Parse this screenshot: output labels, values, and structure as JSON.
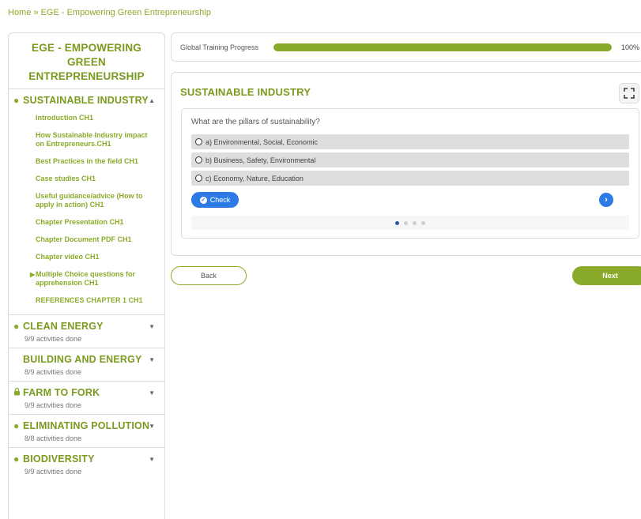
{
  "breadcrumb": {
    "home": "Home",
    "separator": "»",
    "current": "EGE - Empowering Green Entrepreneurship"
  },
  "sidebar": {
    "course_title": "EGE - EMPOWERING GREEN ENTREPRENEURSHIP",
    "chapters": [
      {
        "title": "SUSTAINABLE INDUSTRY",
        "bullet": "●",
        "toggle": "▲",
        "expanded": true,
        "lessons": [
          "Introduction CH1",
          "How Sustainable Industry impact on Entrepreneurs.CH1",
          "Best Practices in the field CH1",
          "Case studies CH1",
          "Useful guidance/advice (How to apply in action) CH1",
          "Chapter Presentation CH1",
          "Chapter Document PDF CH1",
          "Chapter video CH1",
          "Multiple Choice questions for apprehension CH1",
          "REFERENCES CHAPTER 1 CH1"
        ],
        "current_lesson_caret": "▶"
      },
      {
        "title": "CLEAN ENERGY",
        "bullet": "●",
        "toggle": "▼",
        "status": "9/9 activities done"
      },
      {
        "title": "BUILDING AND ENERGY",
        "bullet": "",
        "toggle": "▼",
        "status": "8/9 activities done"
      },
      {
        "title": "FARM TO FORK",
        "bullet": "🔒",
        "icon": "lock-icon",
        "toggle": "▼",
        "status": "9/9 activities done"
      },
      {
        "title": "ELIMINATING POLLUTION",
        "bullet": "●",
        "toggle": "▼",
        "status": "8/8 activities done"
      },
      {
        "title": "BIODIVERSITY",
        "bullet": "●",
        "toggle": "▼",
        "status": "9/9 activities done"
      }
    ]
  },
  "progress": {
    "label": "Global Training Progress",
    "value_text": "100%",
    "fraction": 1.0
  },
  "section": {
    "title": "SUSTAINABLE INDUSTRY"
  },
  "quiz": {
    "question": "What are the pillars of sustainability?",
    "options": [
      "a) Environmental, Social, Economic",
      "b) Business, Safety, Environmental",
      "c) Economy, Nature, Education"
    ],
    "check_label": "Check",
    "next_arrow": "›",
    "page_dots": 4,
    "active_dot": 0
  },
  "nav": {
    "back_label": "Back",
    "next_label": "Next"
  },
  "colors": {
    "accent": "#8aab2a",
    "button_blue": "#2c7be5"
  }
}
